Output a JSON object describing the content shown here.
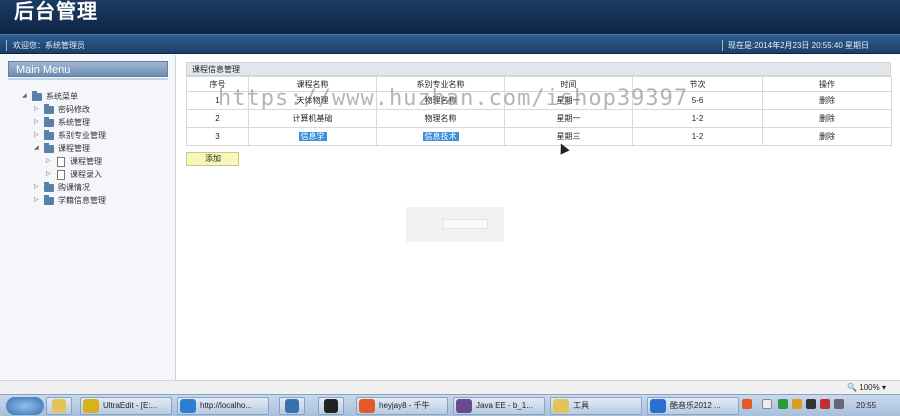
{
  "header": {
    "title": "后台管理"
  },
  "subbar": {
    "welcome": "欢迎您：系统管理员",
    "clock": "现在是:2014年2月23日  20:55:40 星期日"
  },
  "sidebar": {
    "heading": "Main Menu",
    "tree": [
      {
        "label": "系统菜单",
        "level": 0,
        "expanded": true,
        "type": "folder"
      },
      {
        "label": "密码修改",
        "level": 1,
        "expanded": false,
        "type": "folder"
      },
      {
        "label": "系统管理",
        "level": 1,
        "expanded": false,
        "type": "folder"
      },
      {
        "label": "系别专业管理",
        "level": 1,
        "expanded": false,
        "type": "folder"
      },
      {
        "label": "课程管理",
        "level": 1,
        "expanded": true,
        "type": "folder"
      },
      {
        "label": "课程管理",
        "level": 2,
        "type": "doc"
      },
      {
        "label": "课程录入",
        "level": 2,
        "type": "doc"
      },
      {
        "label": "购课情况",
        "level": 1,
        "expanded": false,
        "type": "folder"
      },
      {
        "label": "学籍信息管理",
        "level": 1,
        "expanded": false,
        "type": "folder"
      }
    ]
  },
  "content": {
    "panel_title": "课程信息管理",
    "columns": [
      "序号",
      "课程名称",
      "系别专业名称",
      "时间",
      "节次",
      "操作"
    ],
    "rows": [
      {
        "no": "1",
        "course": "天体物理",
        "major": "物理名称",
        "time": "星期一",
        "period": "5-6",
        "action": "删除",
        "highlight": false
      },
      {
        "no": "2",
        "course": "计算机基础",
        "major": "物理名称",
        "time": "星期一",
        "period": "1-2",
        "action": "删除",
        "highlight": false
      },
      {
        "no": "3",
        "course": "信息学",
        "major": "信息技术",
        "time": "星期三",
        "period": "1-2",
        "action": "删除",
        "highlight": true
      }
    ],
    "add_label": "添加"
  },
  "watermark": "https://www.huzhan.com/ishop39397",
  "statusbar": {
    "zoom": "100%"
  },
  "taskbar": {
    "tasks": [
      {
        "label": "UltraEdit - [E:...",
        "color": "#d8b21a"
      },
      {
        "label": "http://localho...",
        "color": "#2f7fd0"
      },
      {
        "label": "heyjay8 - 千牛",
        "color": "#e05a2a"
      },
      {
        "label": "Java EE - b_1...",
        "color": "#6a4a8e"
      },
      {
        "label": "工具",
        "color": "#e6c25a"
      },
      {
        "label": "酷音乐2012 ...",
        "color": "#2a6fd0"
      }
    ],
    "quick_icons": [
      {
        "name": "network-icon",
        "color": "#3a6fb0"
      },
      {
        "name": "qq-icon",
        "color": "#222222"
      }
    ],
    "time": "20:55"
  },
  "colors": {
    "header": "#1c3a63",
    "subbar": "#2d5c8e",
    "add_button": "#f5f8b8",
    "selection": "#3b8fdb"
  }
}
